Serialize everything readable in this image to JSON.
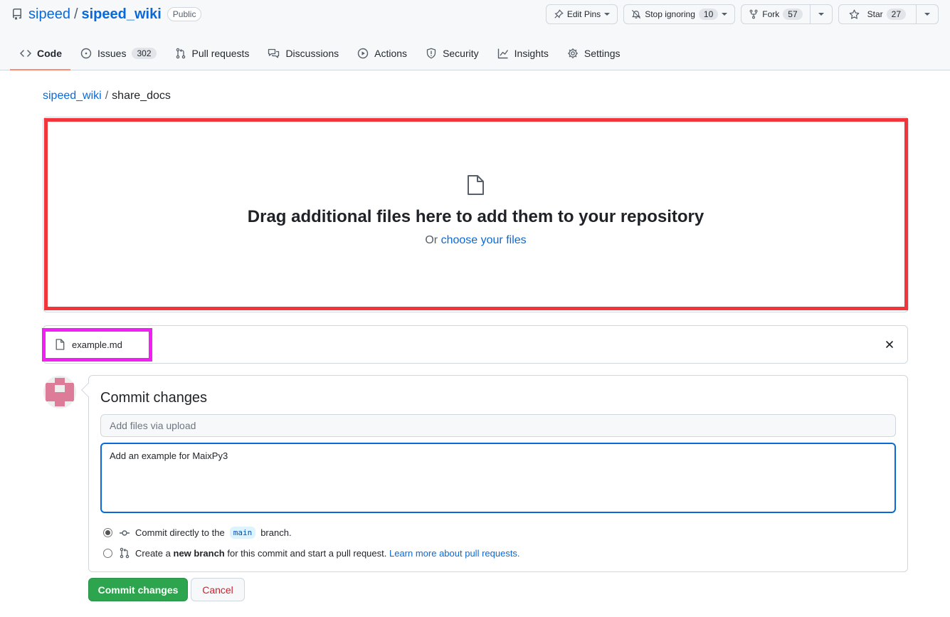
{
  "repo": {
    "owner": "sipeed",
    "separator": "/",
    "name": "sipeed_wiki",
    "visibility": "Public"
  },
  "header_actions": {
    "edit_pins": "Edit Pins",
    "stop_ignoring": "Stop ignoring",
    "watch_count": "10",
    "fork": "Fork",
    "fork_count": "57",
    "star": "Star",
    "star_count": "27"
  },
  "tabs": [
    {
      "label": "Code",
      "icon": "code-icon",
      "active": true
    },
    {
      "label": "Issues",
      "icon": "issue-icon",
      "count": "302"
    },
    {
      "label": "Pull requests",
      "icon": "pull-request-icon"
    },
    {
      "label": "Discussions",
      "icon": "discussion-icon"
    },
    {
      "label": "Actions",
      "icon": "play-icon"
    },
    {
      "label": "Security",
      "icon": "shield-icon"
    },
    {
      "label": "Insights",
      "icon": "graph-icon"
    },
    {
      "label": "Settings",
      "icon": "gear-icon"
    }
  ],
  "breadcrumb": {
    "repo": "sipeed_wiki",
    "separator": "/",
    "directory": "share_docs"
  },
  "dropzone": {
    "title": "Drag additional files here to add them to your repository",
    "prefix": "Or",
    "link": "choose your files"
  },
  "files": [
    {
      "name": "example.md"
    }
  ],
  "commit": {
    "title": "Commit changes",
    "summary_placeholder": "Add files via upload",
    "description": "Add an example for MaixPy3",
    "option_direct_prefix": "Commit directly to the",
    "branch": "main",
    "option_direct_suffix": "branch.",
    "option_new_prefix": "Create a",
    "option_new_bold": "new branch",
    "option_new_suffix": "for this commit and start a pull request.",
    "learn_more": "Learn more about pull requests.",
    "commit_button": "Commit changes",
    "cancel_button": "Cancel"
  },
  "colors": {
    "link": "#0969da",
    "primary_button": "#2da44e",
    "danger": "#cf222e",
    "dropzone_highlight": "#f2353a",
    "file_highlight": "#f21ff5",
    "active_tab_underline": "#fd8c73"
  }
}
